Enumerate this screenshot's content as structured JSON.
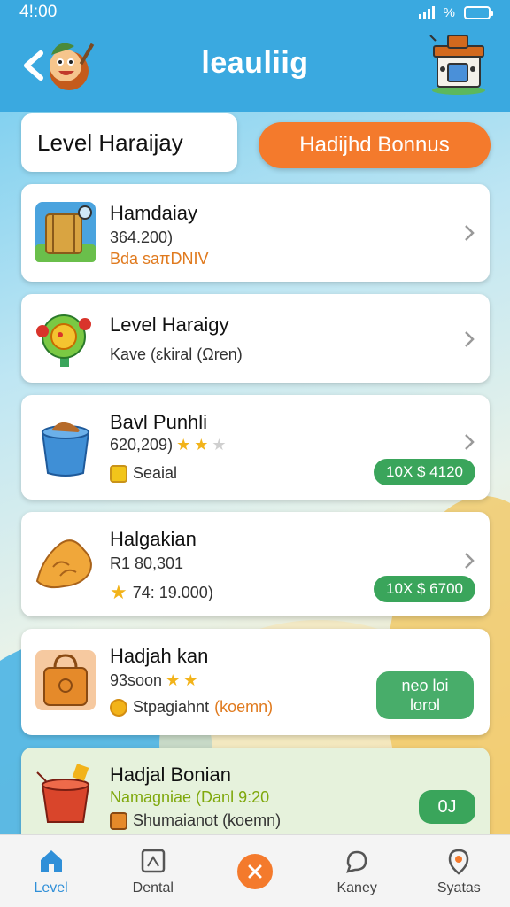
{
  "status_bar": {
    "time": "4!:00",
    "network": "%"
  },
  "header": {
    "title": "leauliig"
  },
  "top": {
    "level_label": "Level Haraijay",
    "bonus_label": "Hadijhd Bonnus"
  },
  "cards": [
    {
      "name": "Hamdaiay",
      "sub": "364.200)",
      "note": "Bda saπDNIV",
      "note_color": "#e07a1e"
    },
    {
      "name": "Level Haraigy",
      "sub": "Kave (ɛkiral (Ωren)"
    },
    {
      "name": "Bavl Punhli",
      "sub": "620,209)",
      "stars": 2,
      "note": "Seaial",
      "badge": "10X $ 4120"
    },
    {
      "name": "Halgakian",
      "sub": "R1 80,301",
      "note": "74: 19.000)",
      "badge": "10X $ 6700"
    },
    {
      "name": "Hadjah kan",
      "sub": "93soon",
      "stars": 2,
      "note": "Stpagiahnt",
      "note_highlight": "(koemn)",
      "button_line1": "neo loi",
      "button_line2": "lorol"
    },
    {
      "name": "Hadjal Bonian",
      "sub": "Namagniae (Danl 9:20",
      "sub_color": "#7fa80c",
      "note": "Shumaianot (koemn)",
      "badge": "0J"
    }
  ],
  "nav": [
    {
      "label": "Level",
      "icon": "home-icon",
      "active": true
    },
    {
      "label": "Dental",
      "icon": "frame-icon"
    },
    {
      "label": "",
      "icon": "close-icon"
    },
    {
      "label": "Kaney",
      "icon": "chat-icon"
    },
    {
      "label": "Syatas",
      "icon": "pin-icon"
    }
  ],
  "colors": {
    "header": "#3aa9e0",
    "accent": "#f47a2c",
    "green": "#3aa55b",
    "active_nav": "#2f8fd8"
  }
}
